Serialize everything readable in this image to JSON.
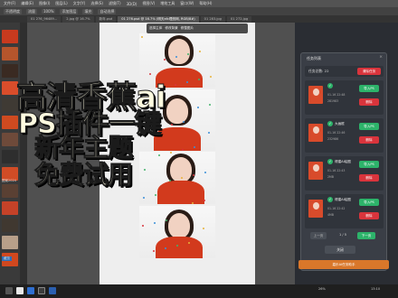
{
  "app": {
    "menu_items": [
      "文件(F)",
      "编辑(E)",
      "图像(I)",
      "图层(L)",
      "文字(Y)",
      "选择(S)",
      "滤镜(T)",
      "3D(D)",
      "视图(V)",
      "增效工具",
      "窗口(W)",
      "帮助(H)"
    ],
    "options": [
      "不透明度",
      "流量",
      "100%",
      "添加图层",
      "填充",
      "自动选择"
    ],
    "tabs": [
      "01 276_96489...",
      "2.jpg @ 16.7%",
      "新年.psd",
      "01 276.psd @ 16.7% (明天afc理然网, RGB/8#)",
      "01 283.jpg",
      "01 272.jpg"
    ],
    "active_tab_index": 3
  },
  "left_panel": {
    "library_labels": [
      "图案2024",
      "藏览"
    ],
    "colors": [
      "#c83a1e",
      "#b5552c",
      "#3a2a22",
      "#d94d2b",
      "#3f3a34",
      "#cf4a20",
      "#6e4a3a",
      "#2e2e2e",
      "#d14c26",
      "#5a4033",
      "#c54228",
      "#403830",
      "#b8a08a",
      "#d0481f"
    ]
  },
  "overlay_text": {
    "line1": "高清香蕉ai",
    "line2": "PS插件一键",
    "line3": "新年主题",
    "line4": "免费试用"
  },
  "canvas_panel": {
    "actions": [
      "选择主体",
      "修改背景",
      "修整图片"
    ],
    "photos": 4
  },
  "task_dialog": {
    "title": "任务列表",
    "close_icon": "×",
    "summary_label": "任务总数: 22",
    "clear_button": "清除任务",
    "tasks": [
      {
        "name": "",
        "time": "01-16 22:48",
        "size": "281983",
        "load_button": "导入PS",
        "delete_button": "删除"
      },
      {
        "name": "大画框",
        "time": "01-16 22:46",
        "size": "232986",
        "load_button": "导入PS",
        "delete_button": "删除"
      },
      {
        "name": "得建AI绘图",
        "time": "01-16 22:43",
        "size": "2MB",
        "load_button": "导入PS",
        "delete_button": "删除"
      },
      {
        "name": "得建AI绘图",
        "time": "01-16 22:42",
        "size": "4MB",
        "load_button": "导入PS",
        "delete_button": "删除"
      }
    ],
    "pager": {
      "prev": "上一页",
      "info": "1 / 5",
      "next": "下一页"
    },
    "close_button": "关闭",
    "bottom_bar": "嘉乐AI任务助手"
  },
  "status": {
    "zoom": "26%",
    "time": "13:10"
  }
}
